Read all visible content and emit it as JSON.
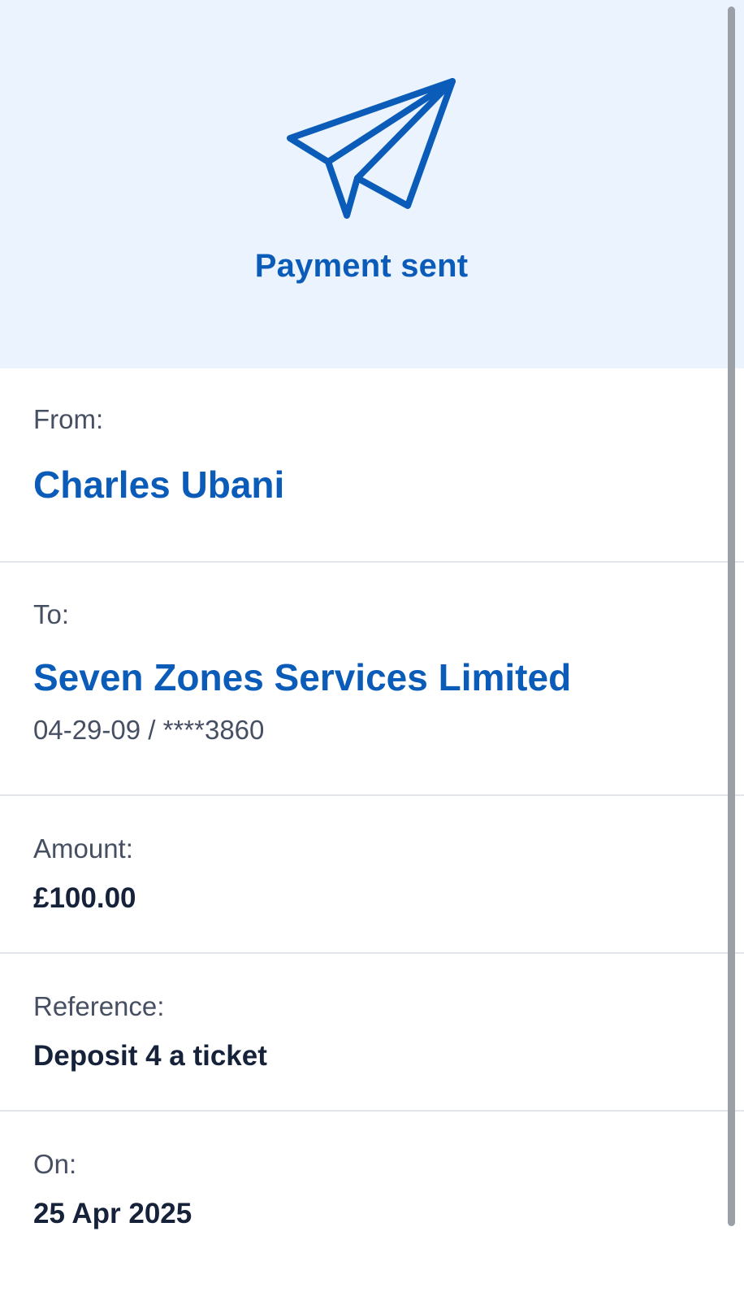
{
  "header": {
    "icon": "paper-plane-icon",
    "title": "Payment sent"
  },
  "from": {
    "label": "From:",
    "name": "Charles Ubani"
  },
  "to": {
    "label": "To:",
    "name": "Seven Zones Services Limited",
    "account": "04-29-09 / ****3860"
  },
  "amount": {
    "label": "Amount:",
    "value": "£100.00"
  },
  "reference": {
    "label": "Reference:",
    "value": "Deposit 4 a ticket"
  },
  "date": {
    "label": "On:",
    "value": "25 Apr 2025"
  },
  "colors": {
    "accent": "#0a5cb8",
    "header_bg": "#ebf4fe",
    "text_dark": "#16213a",
    "text_muted": "#475063",
    "divider": "#e2e5ea"
  }
}
